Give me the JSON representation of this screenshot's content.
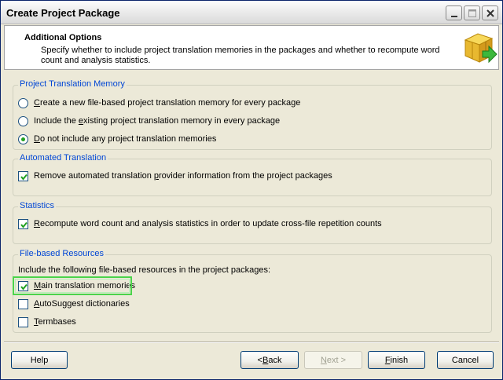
{
  "window": {
    "title": "Create Project Package"
  },
  "header": {
    "title": "Additional Options",
    "description": "Specify whether to include project translation memories in the packages and whether to recompute word count and analysis statistics."
  },
  "groups": {
    "tm": {
      "legend": "Project Translation Memory",
      "options": [
        {
          "pre": "",
          "key": "C",
          "post": "reate a new file-based project translation memory for every package",
          "checked": false
        },
        {
          "pre": "Include the ",
          "key": "e",
          "post": "xisting project translation memory in every package",
          "checked": false
        },
        {
          "pre": "",
          "key": "D",
          "post": "o not include any project translation memories",
          "checked": true
        }
      ]
    },
    "automated": {
      "legend": "Automated Translation",
      "option": {
        "pre": "Remove automated translation ",
        "key": "p",
        "post": "rovider information from the project packages",
        "checked": true
      }
    },
    "statistics": {
      "legend": "Statistics",
      "option": {
        "pre": "",
        "key": "R",
        "post": "ecompute word count and analysis statistics in order to update cross-file repetition counts",
        "checked": true
      }
    },
    "resources": {
      "legend": "File-based Resources",
      "intro": "Include the following file-based resources in the project packages:",
      "items": [
        {
          "pre": "",
          "key": "M",
          "post": "ain translation memories",
          "checked": true
        },
        {
          "pre": "",
          "key": "A",
          "post": "utoSuggest dictionaries",
          "checked": false
        },
        {
          "pre": "",
          "key": "T",
          "post": "ermbases",
          "checked": false
        }
      ]
    }
  },
  "buttons": {
    "help": "Help",
    "back_key": "B",
    "back_rest": "ack",
    "back_prefix": "< ",
    "next_key": "N",
    "next_rest": "ext >",
    "finish_key": "F",
    "finish_rest": "inish",
    "cancel": "Cancel"
  },
  "colors": {
    "legend": "#0046d5",
    "highlight": "#4bd44b",
    "radio_dot": "#21a121"
  },
  "icons": {
    "header": "package-box-arrow-icon"
  }
}
